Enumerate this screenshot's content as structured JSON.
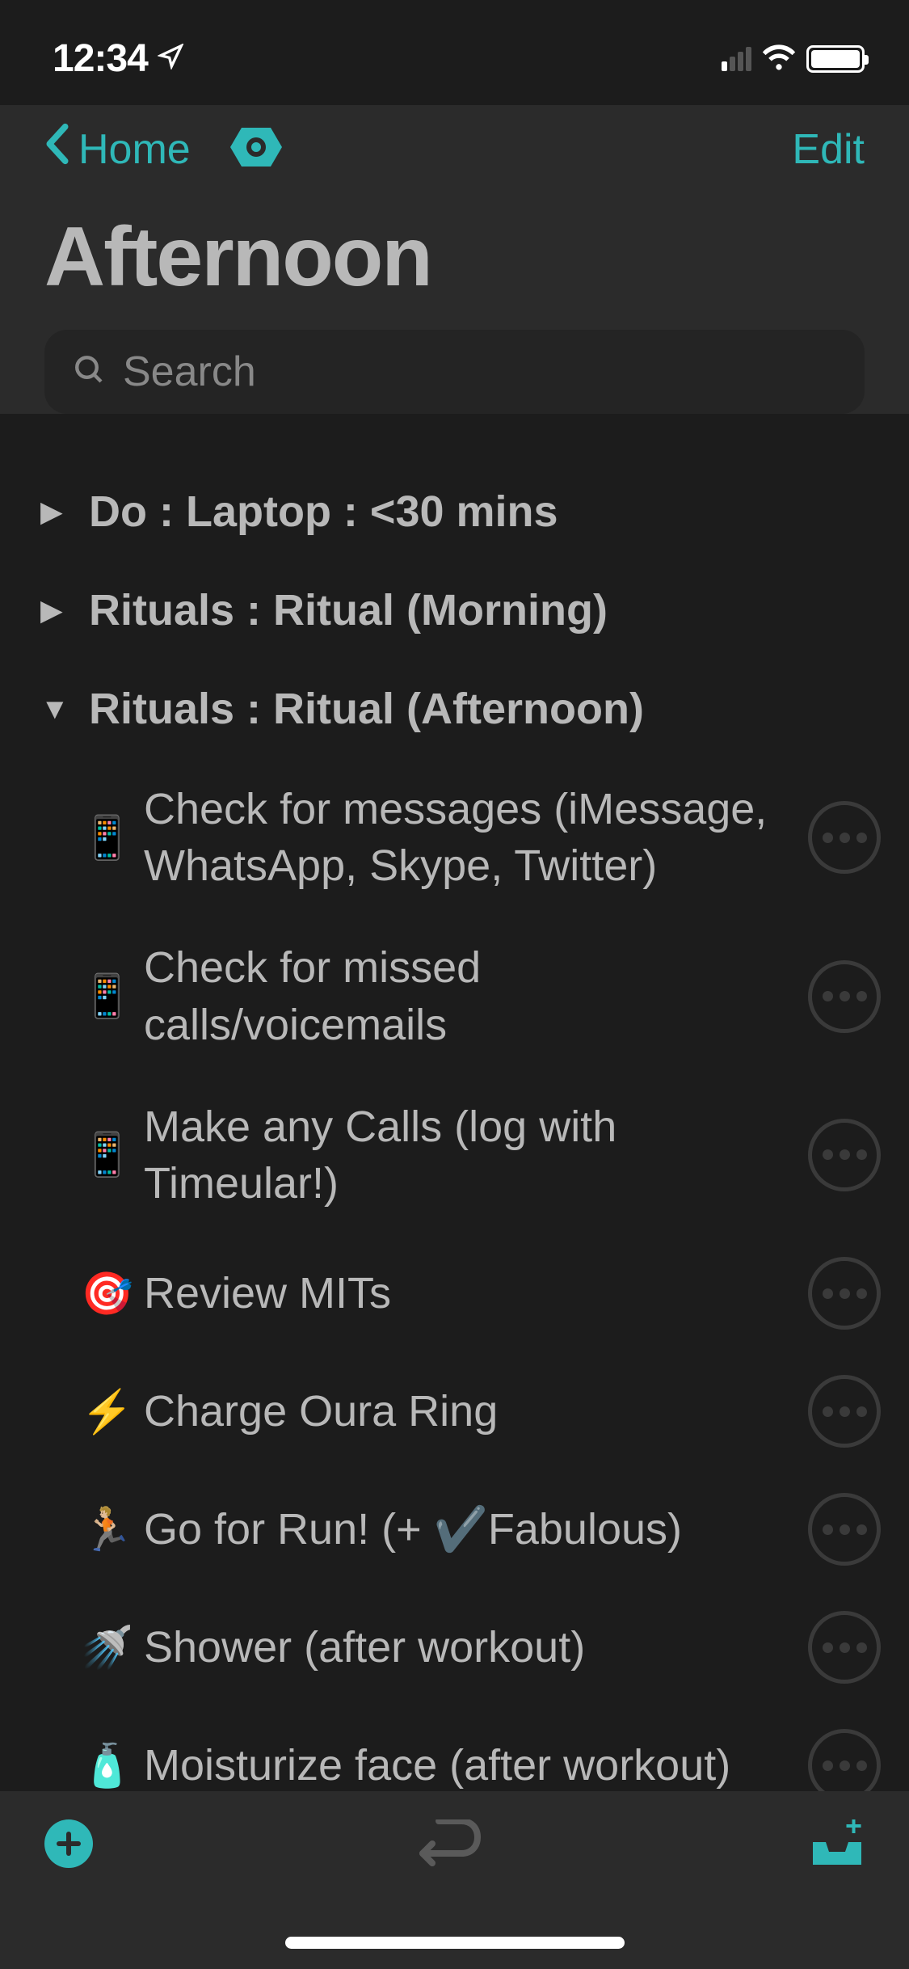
{
  "statusBar": {
    "time": "12:34"
  },
  "nav": {
    "backLabel": "Home",
    "editLabel": "Edit"
  },
  "title": "Afternoon",
  "search": {
    "placeholder": "Search"
  },
  "sections": [
    {
      "title": "Do : Laptop : <30 mins",
      "expanded": false
    },
    {
      "title": "Rituals : Ritual (Morning)",
      "expanded": false
    },
    {
      "title": "Rituals : Ritual (Afternoon)",
      "expanded": true
    }
  ],
  "tasks": [
    {
      "emoji": "📱",
      "text": "Check for messages (iMessage, WhatsApp, Skype, Twitter)"
    },
    {
      "emoji": "📱",
      "text": "Check for missed calls/voicemails"
    },
    {
      "emoji": "📱",
      "text": "Make any Calls (log with Timeular!)"
    },
    {
      "emoji": "🎯",
      "text": "Review MITs"
    },
    {
      "emoji": "⚡",
      "text": "Charge Oura Ring"
    },
    {
      "emoji": "🏃🏼",
      "text": "Go for Run! (+ ✔️Fabulous)"
    },
    {
      "emoji": "🚿",
      "text": "Shower (after workout)"
    },
    {
      "emoji": "🧴",
      "text": "Moisturize face (after workout)"
    }
  ]
}
